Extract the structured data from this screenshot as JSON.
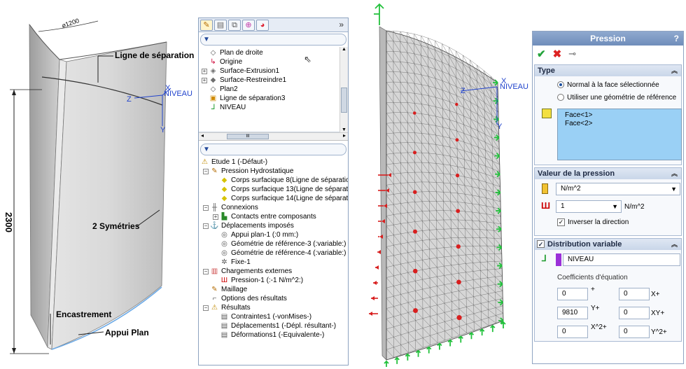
{
  "geometry": {
    "dim_diameter": "⌀1200",
    "label_ligne": "Ligne de séparation",
    "label_symetries": "2 Symétries",
    "label_encastrement": "Encastrement",
    "label_appui": "Appui Plan",
    "dim_height": "2300",
    "axis_x": "X",
    "axis_y": "Y",
    "axis_z": "Z",
    "axis_niveau": "NIVEAU"
  },
  "tree": {
    "features": [
      {
        "label": "Plan de droite",
        "icon": "plane-icon"
      },
      {
        "label": "Origine",
        "icon": "origin-icon"
      },
      {
        "label": "Surface-Extrusion1",
        "icon": "surface-extrude-icon"
      },
      {
        "label": "Surface-Restreindre1",
        "icon": "surface-trim-icon"
      },
      {
        "label": "Plan2",
        "icon": "plane-icon"
      },
      {
        "label": "Ligne de séparation3",
        "icon": "split-line-icon"
      },
      {
        "label": "NIVEAU",
        "icon": "coordinate-system-icon"
      }
    ],
    "study": [
      {
        "label": "Etude 1 (-Défaut-)",
        "indent": 0,
        "icon": "study-warning-icon"
      },
      {
        "label": "Pression Hydrostatique",
        "indent": 1,
        "icon": "part-icon"
      },
      {
        "label": "Corps surfacique 8(Ligne de séparatio",
        "indent": 2,
        "icon": "shell-body-icon"
      },
      {
        "label": "Corps surfacique 13(Ligne de séparati",
        "indent": 2,
        "icon": "shell-body-icon"
      },
      {
        "label": "Corps surfacique 14(Ligne de séparati",
        "indent": 2,
        "icon": "shell-body-icon"
      },
      {
        "label": "Connexions",
        "indent": 1,
        "icon": "connections-icon"
      },
      {
        "label": "Contacts entre composants",
        "indent": 2,
        "icon": "contact-icon"
      },
      {
        "label": "Déplacements imposés",
        "indent": 1,
        "icon": "fixtures-icon"
      },
      {
        "label": "Appui plan-1 (:0 mm:)",
        "indent": 2,
        "icon": "fixture-icon"
      },
      {
        "label": "Géométrie de référence-3 (:variable:)",
        "indent": 2,
        "icon": "fixture-icon"
      },
      {
        "label": "Géométrie de référence-4 (:variable:)",
        "indent": 2,
        "icon": "fixture-icon"
      },
      {
        "label": "Fixe-1",
        "indent": 2,
        "icon": "fixed-icon"
      },
      {
        "label": "Chargements externes",
        "indent": 1,
        "icon": "loads-icon"
      },
      {
        "label": "Pression-1 (:-1 N/m^2:)",
        "indent": 2,
        "icon": "pressure-icon"
      },
      {
        "label": "Maillage",
        "indent": 1,
        "icon": "mesh-icon"
      },
      {
        "label": "Options des résultats",
        "indent": 1,
        "icon": "result-options-icon"
      },
      {
        "label": "Résultats",
        "indent": 1,
        "icon": "results-warning-icon"
      },
      {
        "label": "Contraintes1 (-vonMises-)",
        "indent": 2,
        "icon": "plot-icon"
      },
      {
        "label": "Déplacements1 (-Dépl. résultant-)",
        "indent": 2,
        "icon": "plot-icon"
      },
      {
        "label": "Déformations1 (-Equivalente-)",
        "indent": 2,
        "icon": "plot-icon"
      }
    ],
    "hscroll_glyph": "III"
  },
  "mesh": {
    "axis_x": "X",
    "axis_y": "Y",
    "axis_z": "Z",
    "axis_niveau": "NIVEAU"
  },
  "pressure_pm": {
    "title": "Pression",
    "help": "?",
    "type_group": {
      "title": "Type",
      "option_normal": "Normal à la face sélectionnée",
      "option_reference": "Utiliser une géométrie de référence",
      "faces": [
        "Face<1>",
        "Face<2>"
      ]
    },
    "value_group": {
      "title": "Valeur de la pression",
      "unit_selected": "N/m^2",
      "value": "1",
      "value_unit": "N/m^2",
      "invert_label": "Inverser la direction"
    },
    "dist_group": {
      "title": "Distribution variable",
      "coord_system": "NIVEAU",
      "coeff_label": "Coefficients d'équation",
      "coeffs": [
        {
          "a": "0",
          "a_term": "+",
          "b": "0",
          "b_term": "X+"
        },
        {
          "a": "9810",
          "a_term": "Y+",
          "b": "0",
          "b_term": "XY+"
        },
        {
          "a": "0",
          "a_term": "X^2+",
          "b": "0",
          "b_term": "Y^2+"
        }
      ]
    }
  },
  "colors": {
    "accent": "#7b98c7",
    "face_box": "#9ad0f5",
    "arrow_red": "#d81e1e",
    "fixture_green": "#22c13c"
  }
}
